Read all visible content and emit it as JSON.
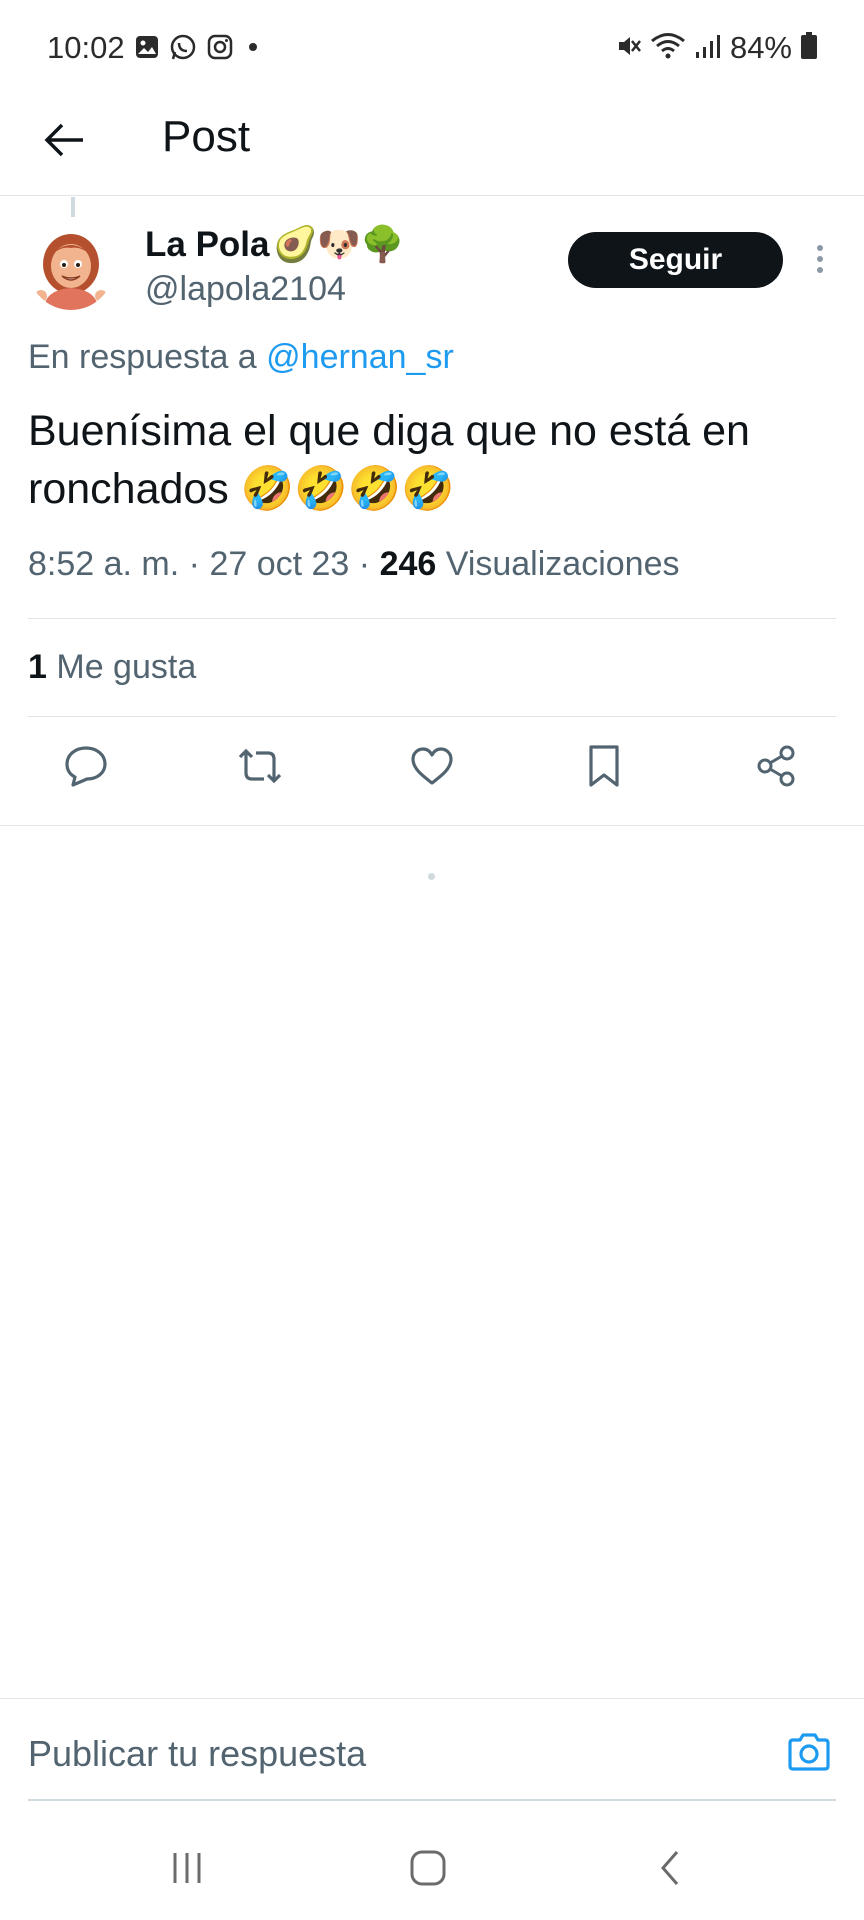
{
  "status_bar": {
    "time": "10:02",
    "left_icons": [
      "gallery-icon",
      "whatsapp-icon",
      "instagram-icon",
      "notification-dot-icon"
    ],
    "right_icons": [
      "mute-icon",
      "wifi-icon",
      "signal-icon",
      "battery-icon"
    ],
    "battery": "84%"
  },
  "header": {
    "back_icon": "arrow-left-icon",
    "title": "Post"
  },
  "post": {
    "author_name": "La Pola",
    "author_emojis": "🥑🐶🌳",
    "author_handle": "@lapola2104",
    "follow_label": "Seguir",
    "more_icon": "more-vertical-icon",
    "reply_prefix": "En respuesta a",
    "reply_mention": "@hernan_sr",
    "text": "Buenísima el que diga que no está en ronchados 🤣🤣🤣🤣",
    "time": "8:52 a. m.",
    "date": "27 oct 23",
    "views_count": "246",
    "views_label": "Visualizaciones",
    "likes_count": "1",
    "likes_label": "Me gusta"
  },
  "actions": [
    {
      "icon": "reply-icon"
    },
    {
      "icon": "retweet-icon"
    },
    {
      "icon": "like-heart-icon"
    },
    {
      "icon": "bookmark-icon"
    },
    {
      "icon": "share-icon"
    }
  ],
  "composer": {
    "placeholder": "Publicar tu respuesta",
    "camera_icon": "camera-icon"
  },
  "nav_bar": {
    "recents_icon": "recents-icon",
    "home_icon": "home-icon",
    "back_icon": "back-chevron-icon"
  },
  "colors": {
    "accent": "#1d9bf0",
    "text_primary": "#0f1419",
    "text_secondary": "#536471",
    "follow_button": "#0f1419"
  }
}
